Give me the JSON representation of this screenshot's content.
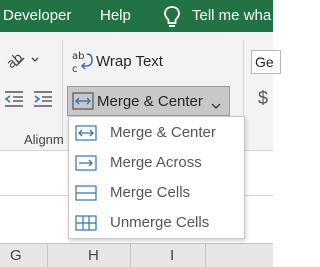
{
  "ribbon_tabs": {
    "developer": "Developer",
    "help": "Help",
    "tell_me": "Tell me wha"
  },
  "alignment_group": {
    "label": "Alignm",
    "wrap_text_label": "Wrap Text",
    "merge_center_label": "Merge & Center",
    "orientation_icon": "orientation-icon",
    "decrease_indent_icon": "decrease-indent-icon",
    "increase_indent_icon": "increase-indent-icon"
  },
  "number_group": {
    "format_value": "Ge",
    "currency_symbol": "$"
  },
  "merge_menu": {
    "items": [
      {
        "label": "Merge & Center",
        "icon": "merge-center-icon"
      },
      {
        "label": "Merge Across",
        "icon": "merge-across-icon"
      },
      {
        "label": "Merge Cells",
        "icon": "merge-cells-icon"
      },
      {
        "label": "Unmerge Cells",
        "icon": "unmerge-cells-icon"
      }
    ]
  },
  "columns": [
    "G",
    "H",
    "I"
  ],
  "colors": {
    "tab_bar": "#217346",
    "ribbon_bg": "#f3f3f3",
    "pressed_button": "#c8c8c8",
    "icon_blue": "#2e75b6"
  }
}
